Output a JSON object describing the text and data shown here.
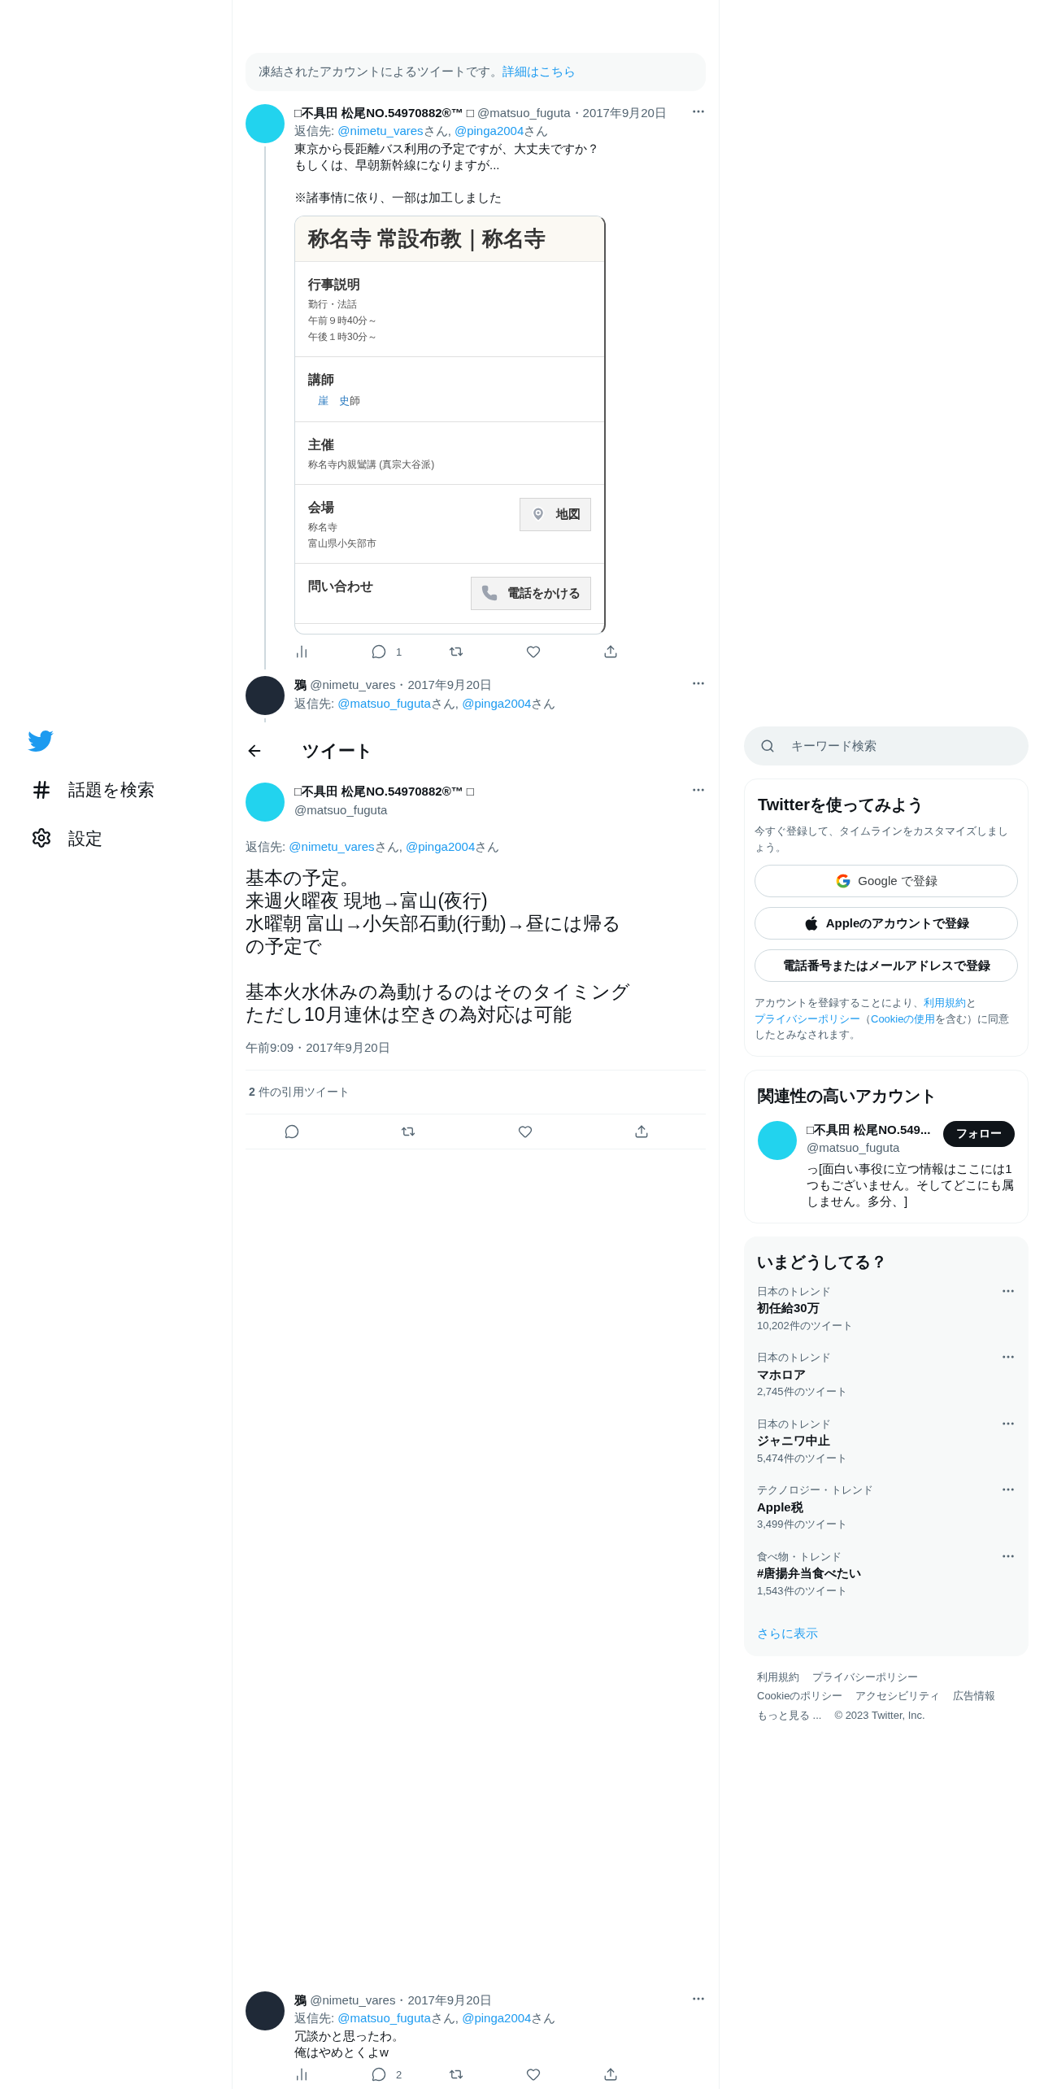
{
  "notice": {
    "text": "凍結されたアカウントによるツイートです。",
    "link": "詳細はこちら"
  },
  "thread": [
    {
      "kind": "card",
      "avatar": {
        "color": "#22d3ee"
      },
      "name": "□不具田 松尾NO.54970882®™ □",
      "handle": "@matsuo_fuguta",
      "date": "・2017年9月20日",
      "reply": {
        "label": "返信先:",
        "mentions": [
          {
            "handle": "@nimetu_vares",
            "suffix": "さん,"
          },
          {
            "handle": "@pinga2004",
            "suffix": "さん"
          }
        ]
      },
      "paragraphs": [
        [
          "東京から長距離バス利用の予定ですが、大丈夫ですか？",
          "もしくは、早朝新幹線になりますが..."
        ],
        [
          "※諸事情に依り、一部は加工しました"
        ]
      ],
      "card": {
        "title": "称名寺 常設布教｜称名寺",
        "sections": [
          {
            "heading": "行事説明",
            "lines": [
              "勤行・法話",
              "午前９時40分～",
              "午後１時30分～"
            ]
          },
          {
            "heading": "講師",
            "person": "崖　史",
            "suffix": "師"
          },
          {
            "heading": "主催",
            "lines": [
              "称名寺内親鸞講 (真宗大谷派)"
            ]
          },
          {
            "heading": "会場",
            "lines": [
              "称名寺",
              "富山県小矢部市"
            ],
            "button": {
              "kind": "map",
              "label": "地図"
            }
          },
          {
            "heading": "問い合わせ",
            "button": {
              "kind": "phone",
              "label": "電話をかける"
            }
          }
        ]
      },
      "actions": [
        {
          "kind": "views"
        },
        {
          "kind": "reply",
          "count": "1"
        },
        {
          "kind": "retweet"
        },
        {
          "kind": "like"
        },
        {
          "kind": "share"
        }
      ]
    },
    {
      "kind": "plain",
      "avatar": {
        "color": "#1f2937"
      },
      "name": "鴉",
      "handle": "@nimetu_vares",
      "date": "・2017年9月20日",
      "reply": {
        "label": "返信先:",
        "mentions": [
          {
            "handle": "@matsuo_fuguta",
            "suffix": "さん,"
          },
          {
            "handle": "@pinga2004",
            "suffix": "さん"
          }
        ]
      }
    }
  ],
  "header": {
    "title": "ツイート"
  },
  "main_tweet": {
    "avatar": {
      "color": "#22d3ee"
    },
    "name": "□不具田 松尾NO.54970882®™ □",
    "handle": "@matsuo_fuguta",
    "reply": {
      "label": "返信先:",
      "mentions": [
        {
          "handle": "@nimetu_vares",
          "suffix": "さん,"
        },
        {
          "handle": "@pinga2004",
          "suffix": "さん"
        }
      ]
    },
    "paragraphs": [
      [
        "基本の予定。",
        "来週火曜夜 現地→富山(夜行)",
        "水曜朝 富山→小矢部石動(行動)→昼には帰る",
        "の予定で"
      ],
      [
        "基本火水休みの為動けるのはそのタイミング",
        "ただし10月連休は空きの為対応は可能"
      ]
    ],
    "time": "午前9:09・2017年9月20日",
    "quotes": "**2** 件の引用ツイート",
    "actions": [
      {
        "kind": "reply"
      },
      {
        "kind": "retweet"
      },
      {
        "kind": "like"
      },
      {
        "kind": "share"
      }
    ]
  },
  "bottom_tweet": {
    "avatar": {
      "color": "#1f2937"
    },
    "name": "鴉",
    "handle": "@nimetu_vares",
    "date": "・2017年9月20日",
    "reply": {
      "label": "返信先:",
      "mentions": [
        {
          "handle": "@matsuo_fuguta",
          "suffix": "さん,"
        },
        {
          "handle": "@pinga2004",
          "suffix": "さん"
        }
      ]
    },
    "paragraphs": [
      [
        "冗談かと思ったわ。",
        "俺はやめとくよw"
      ]
    ],
    "actions": [
      {
        "kind": "views"
      },
      {
        "kind": "reply",
        "count": "2"
      },
      {
        "kind": "retweet"
      },
      {
        "kind": "like"
      },
      {
        "kind": "share"
      }
    ]
  },
  "nav": {
    "items": [
      {
        "kind": "hashtag",
        "label": "話題を検索"
      },
      {
        "kind": "settings",
        "label": "設定"
      }
    ]
  },
  "search": {
    "placeholder": "キーワード検索"
  },
  "signup": {
    "title": "Twitterを使ってみよう",
    "subtitle": "今すぐ登録して、タイムラインをカスタマイズしましょう。",
    "buttons": [
      {
        "kind": "google",
        "label": "Google で登録"
      },
      {
        "kind": "apple",
        "label": "Appleのアカウントで登録"
      },
      {
        "kind": "plain",
        "label": "電話番号またはメールアドレスで登録"
      }
    ],
    "legal": [
      {
        "kind": "text",
        "text": "アカウントを登録することにより、"
      },
      {
        "kind": "link",
        "text": "利用規約"
      },
      {
        "kind": "text",
        "text": "と"
      },
      {
        "kind": "link",
        "text": "プライバシーポリシー"
      },
      {
        "kind": "text",
        "text": "（"
      },
      {
        "kind": "link",
        "text": "Cookieの使用"
      },
      {
        "kind": "text",
        "text": "を含む）に同意したとみなされます。"
      }
    ]
  },
  "related": {
    "title": "関連性の高いアカウント",
    "account": {
      "avatar": {
        "color": "#22d3ee"
      },
      "name": "□不具田 松尾NO.549...",
      "handle": "@matsuo_fuguta",
      "bio": "っ[面白い事役に立つ情報はここには1つもございません。そしてどこにも属しません。多分、]",
      "follow": "フォロー"
    }
  },
  "trends": {
    "title": "いまどうしてる？",
    "items": [
      {
        "category": "日本のトレンド",
        "name": "初任給30万",
        "count": "10,202件のツイート"
      },
      {
        "category": "日本のトレンド",
        "name": "マホロア",
        "count": "2,745件のツイート"
      },
      {
        "category": "日本のトレンド",
        "name": "ジャニワ中止",
        "count": "5,474件のツイート"
      },
      {
        "category": "テクノロジー・トレンド",
        "name": "Apple税",
        "count": "3,499件のツイート"
      },
      {
        "category": "食べ物・トレンド",
        "name": "#唐揚弁当食べたい",
        "count": "1,543件のツイート"
      }
    ],
    "more": "さらに表示"
  },
  "footer": [
    "利用規約",
    "プライバシーポリシー",
    "Cookieのポリシー",
    "アクセシビリティ",
    "広告情報",
    "もっと見る ...",
    "© 2023 Twitter, Inc."
  ]
}
